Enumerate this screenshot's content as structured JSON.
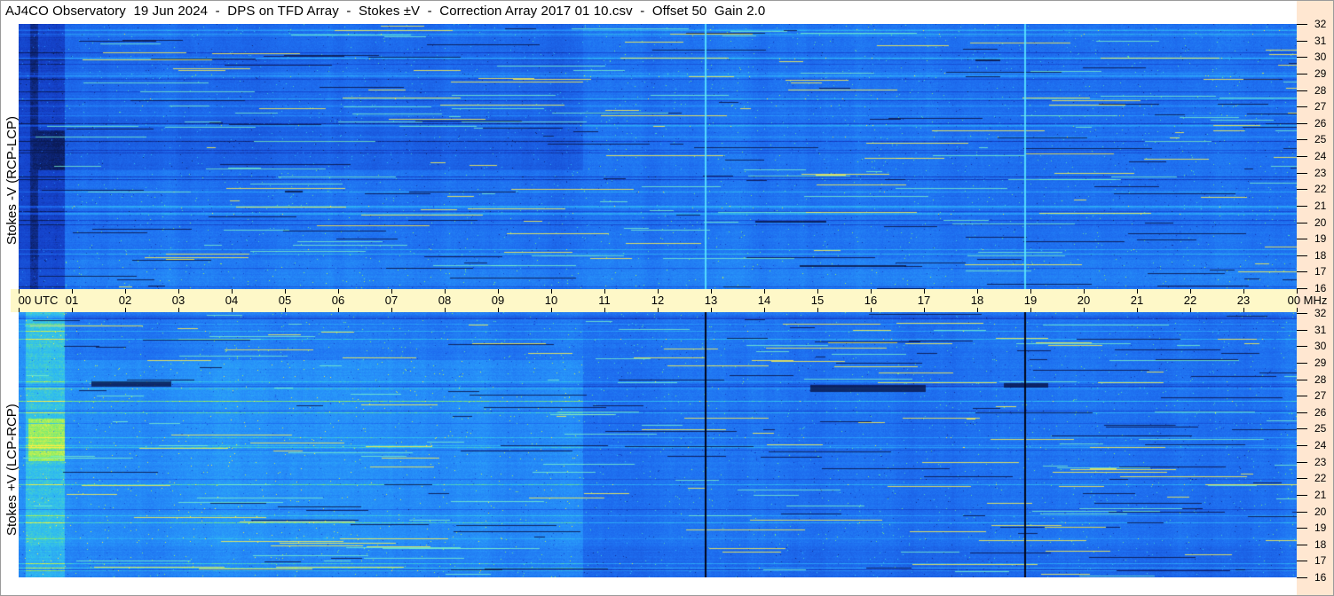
{
  "title": "AJ4CO Observatory  19 Jun 2024  -  DPS on TFD Array  -  Stokes ±V  -  Correction Array 2017 01 10.csv  -  Offset 50  Gain 2.0",
  "chart_data": [
    {
      "type": "heatmap",
      "ylabel": "Stokes -V (RCP-LCP)",
      "ylim": [
        16,
        32
      ],
      "xlim": [
        "00",
        "00"
      ],
      "colormap": [
        "#0a1a55",
        "#1440c8",
        "#2288ff",
        "#33bbee",
        "#88ee66",
        "#ffee44"
      ]
    },
    {
      "type": "heatmap",
      "ylabel": "Stokes +V (LCP-RCP)",
      "ylim": [
        16,
        32
      ],
      "xlim": [
        "00",
        "00"
      ],
      "colormap": [
        "#0a1a55",
        "#1440c8",
        "#2288ff",
        "#33bbee",
        "#88ee66",
        "#ffee44"
      ]
    }
  ],
  "time_axis": {
    "first_label": "00",
    "utc_label": "UTC",
    "hours": [
      "01",
      "02",
      "03",
      "04",
      "05",
      "06",
      "07",
      "08",
      "09",
      "10",
      "11",
      "12",
      "13",
      "14",
      "15",
      "16",
      "17",
      "18",
      "19",
      "20",
      "21",
      "22",
      "23"
    ],
    "last_label": "00",
    "unit": "MHz"
  },
  "freq_axis": [
    "32",
    "31",
    "30",
    "29",
    "28",
    "27",
    "26",
    "25",
    "24",
    "23",
    "22",
    "21",
    "20",
    "19",
    "18",
    "17",
    "16"
  ],
  "colors": {
    "band": "#fef8c8",
    "strip": "#ffe7d1",
    "base": "#1e64ee"
  }
}
